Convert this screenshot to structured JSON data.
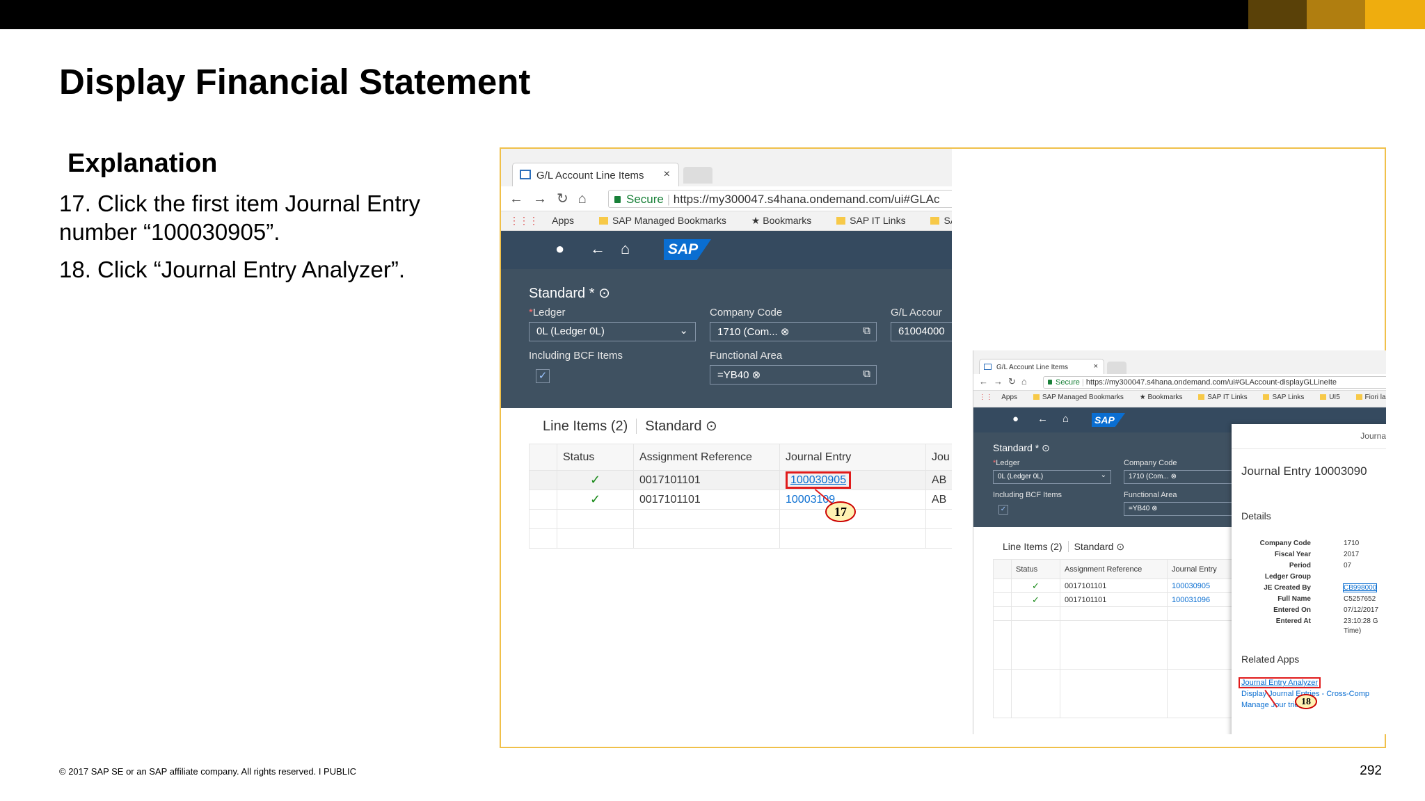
{
  "slide": {
    "title": "Display Financial Statement",
    "explanation_heading": "Explanation",
    "step17": "17.  Click the first item Journal Entry number “100030905”.",
    "step18": "18. Click “Journal Entry Analyzer”.",
    "footer": "© 2017 SAP SE or an SAP affiliate company. All rights reserved.   I   PUBLIC",
    "page_number": "292"
  },
  "colors": {
    "accent_dark": "#5a4108",
    "accent_mid": "#b07e10",
    "accent_light": "#efad0e",
    "shell": "#354a5f",
    "link": "#0a6ed1",
    "highlight": "#e01b1b"
  },
  "screen1": {
    "tab_label": "G/L Account Line Items",
    "secure": "Secure",
    "url": "https://my300047.s4hana.ondemand.com/ui#GLAc",
    "bookmarks": [
      "Apps",
      "SAP Managed Bookmarks",
      "Bookmarks",
      "SAP IT Links",
      "SAP Links"
    ],
    "variant": "Standard *",
    "ledger_label": "Ledger",
    "ledger_value": "0L (Ledger 0L)",
    "company_code_label": "Company Code",
    "company_code_value": "1710 (Com...",
    "gl_account_label": "G/L Accour",
    "gl_account_value": "61004000",
    "bcf_label": "Including BCF Items",
    "functional_area_label": "Functional Area",
    "functional_area_value": "=YB40",
    "line_items_title": "Line Items (2)",
    "line_items_variant": "Standard",
    "columns": [
      "Status",
      "Assignment Reference",
      "Journal Entry",
      "Jou"
    ],
    "rows": [
      {
        "assignment": "0017101101",
        "journal_entry": "100030905",
        "col4": "AB"
      },
      {
        "assignment": "0017101101",
        "journal_entry": "10003109",
        "col4": "AB"
      }
    ],
    "callout": "17"
  },
  "screen2": {
    "tab_label": "G/L Account Line Items",
    "secure": "Secure",
    "url": "https://my300047.s4hana.ondemand.com/ui#GLAccount-displayGLLineIte",
    "bookmarks": [
      "Apps",
      "SAP Managed Bookmarks",
      "Bookmarks",
      "SAP IT Links",
      "SAP Links",
      "UI5",
      "Fiori lanch"
    ],
    "variant": "Standard *",
    "ledger_label": "Ledger",
    "ledger_value": "0L (Ledger 0L)",
    "company_code_label": "Company Code",
    "company_code_value": "1710 (Com...",
    "bcf_label": "Including BCF Items",
    "functional_area_label": "Functional Area",
    "functional_area_value": "=YB40",
    "line_items_title": "Line Items (2)",
    "line_items_variant": "Standard",
    "columns": [
      "Status",
      "Assignment Reference",
      "Journal Entry"
    ],
    "rows": [
      {
        "assignment": "0017101101",
        "journal_entry": "100030905"
      },
      {
        "assignment": "0017101101",
        "journal_entry": "100031096"
      }
    ],
    "panel": {
      "top_title": "Journal E",
      "heading": "Journal Entry 10003090",
      "details_heading": "Details",
      "details": [
        {
          "key": "Company Code",
          "value": "1710"
        },
        {
          "key": "Fiscal Year",
          "value": "2017"
        },
        {
          "key": "Period",
          "value": "07"
        },
        {
          "key": "Ledger Group",
          "value": ""
        },
        {
          "key": "JE Created By",
          "value": "CB998000"
        },
        {
          "key": "Full Name",
          "value": "C5257652"
        },
        {
          "key": "Entered On",
          "value": "07/12/2017"
        },
        {
          "key": "Entered At",
          "value": "23:10:28 G"
        },
        {
          "key": "",
          "value": "Time)"
        }
      ],
      "related_heading": "Related Apps",
      "related_apps": [
        "Journal Entry Analyzer",
        "Display Journal Entries - Cross-Comp",
        "Manage Jour         tries"
      ]
    },
    "callout": "18"
  }
}
